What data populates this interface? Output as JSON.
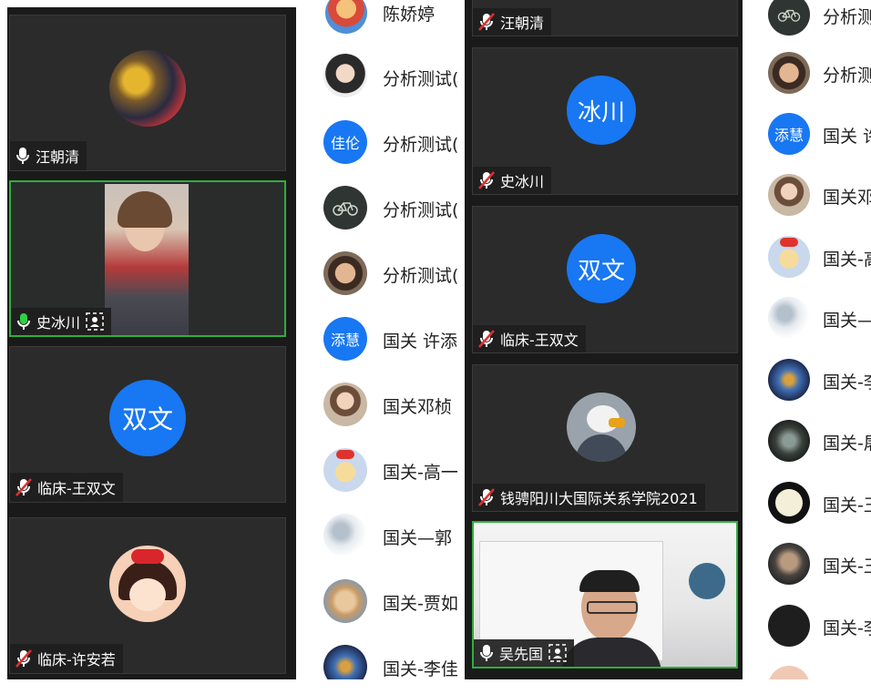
{
  "panel1": {
    "tiles": [
      {
        "name": "汪朝清",
        "mic": "on"
      },
      {
        "name": "史冰川",
        "mic": "speaking"
      },
      {
        "name": "临床-王双文",
        "mic": "muted",
        "initials": "双文"
      },
      {
        "name": "临床-许安若",
        "mic": "muted"
      }
    ]
  },
  "panel2": {
    "rows": [
      {
        "name": "陈娇婷"
      },
      {
        "name": "分析测试("
      },
      {
        "name": "分析测试(",
        "initials": "佳伦"
      },
      {
        "name": "分析测试("
      },
      {
        "name": "分析测试("
      },
      {
        "name": "国关 许添",
        "initials": "添慧"
      },
      {
        "name": "国关邓桢"
      },
      {
        "name": "国关-高一"
      },
      {
        "name": "国关—郭"
      },
      {
        "name": "国关-贾如"
      },
      {
        "name": "国关-李佳"
      }
    ]
  },
  "panel3": {
    "tiles": [
      {
        "name": "汪朝清",
        "mic": "muted"
      },
      {
        "name": "史冰川",
        "mic": "muted",
        "initials": "冰川"
      },
      {
        "name": "临床-王双文",
        "mic": "muted",
        "initials": "双文"
      },
      {
        "name": "钱骋阳川大国际关系学院2021",
        "mic": "muted"
      },
      {
        "name": "吴先国",
        "mic": "on"
      }
    ]
  },
  "panel4": {
    "rows": [
      {
        "name": "分析测"
      },
      {
        "name": "分析测"
      },
      {
        "name": "国关 许",
        "initials": "添慧"
      },
      {
        "name": "国关邓"
      },
      {
        "name": "国关-高"
      },
      {
        "name": "国关—"
      },
      {
        "name": "国关-李"
      },
      {
        "name": "国关-屠"
      },
      {
        "name": "国关-王"
      },
      {
        "name": "国关-王"
      },
      {
        "name": "国关-李"
      }
    ]
  },
  "colors": {
    "accent_blue": "#1877f2",
    "speaking_green": "#2fae3c",
    "muted_red": "#e03030",
    "tile_bg": "#2b2b2b"
  }
}
